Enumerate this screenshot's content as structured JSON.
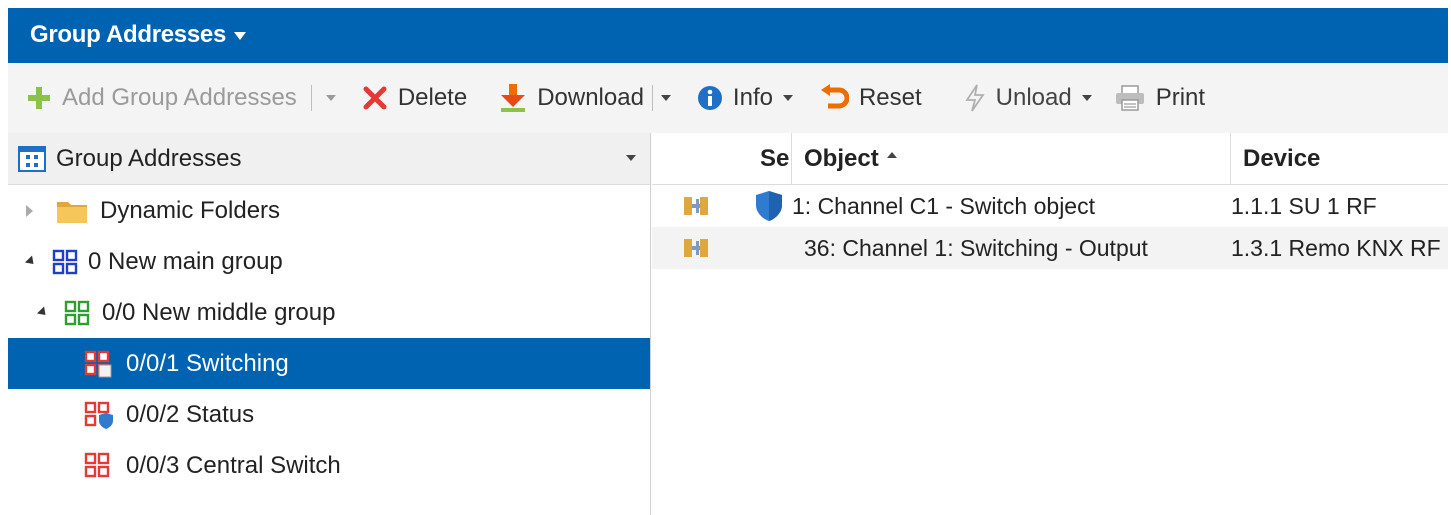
{
  "header": {
    "title": "Group Addresses"
  },
  "toolbar": {
    "add_label": "Add Group Addresses",
    "delete_label": "Delete",
    "download_label": "Download",
    "info_label": "Info",
    "reset_label": "Reset",
    "unload_label": "Unload",
    "print_label": "Print"
  },
  "tree": {
    "header": "Group Addresses",
    "items": [
      {
        "label": "Dynamic Folders",
        "icon": "folder-icon"
      },
      {
        "label": "0 New main group",
        "icon": "main-group-icon"
      },
      {
        "label": "0/0 New middle group",
        "icon": "middle-group-icon"
      },
      {
        "label": "0/0/1 Switching",
        "icon": "group-address-icon",
        "selected": true
      },
      {
        "label": "0/0/2 Status",
        "icon": "group-address-shield-icon"
      },
      {
        "label": "0/0/3 Central Switch",
        "icon": "group-address-icon"
      }
    ]
  },
  "grid": {
    "columns": {
      "se": "Se",
      "object": "Object",
      "device": "Device"
    },
    "rows": [
      {
        "object": "1: Channel C1 - Switch object",
        "device": "1.1.1 SU 1 RF",
        "secure": true
      },
      {
        "object": "36: Channel 1: Switching - Output",
        "device": "1.3.1 Remo KNX RF",
        "secure": false
      }
    ]
  },
  "colors": {
    "accent": "#0063b1",
    "delete": "#e53935",
    "add": "#8bc34a",
    "download": "#ef6c00"
  }
}
